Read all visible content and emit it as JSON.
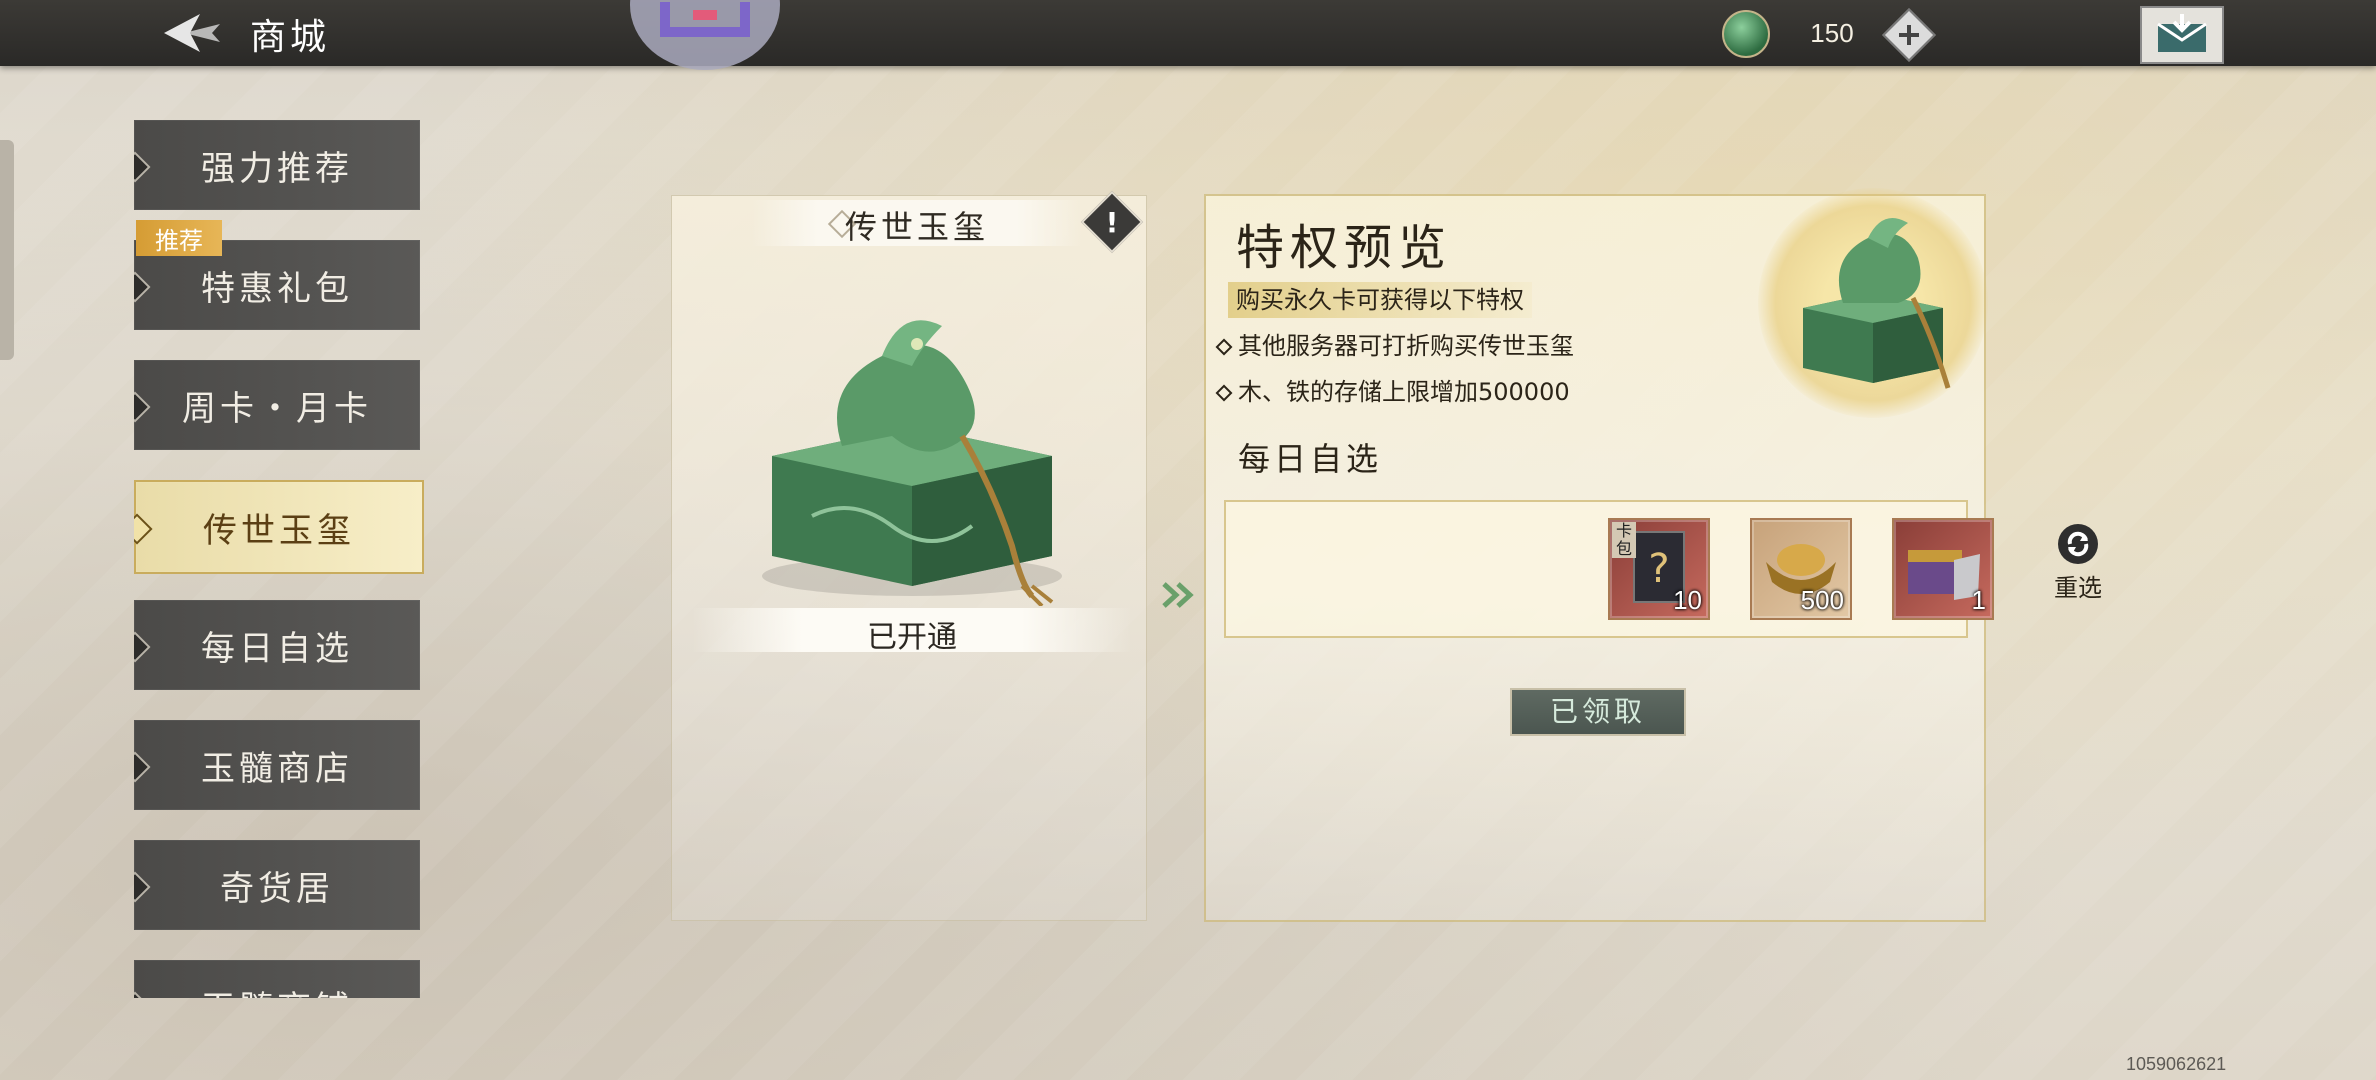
{
  "header": {
    "title": "商城",
    "currency_amount": "150"
  },
  "nav": {
    "items": [
      {
        "label": "强力推荐"
      },
      {
        "label": "特惠礼包"
      },
      {
        "label": "周卡・月卡"
      },
      {
        "label": "传世玉玺"
      },
      {
        "label": "每日自选"
      },
      {
        "label": "玉髓商店"
      },
      {
        "label": "奇货居"
      },
      {
        "label": "玉髓商铺"
      }
    ],
    "active_index": 3,
    "recommend_tag": "推荐"
  },
  "card": {
    "title": "传世玉玺",
    "info_icon": "!",
    "status": "已开通"
  },
  "panel": {
    "title": "特权预览",
    "subtitle": "购买永久卡可获得以下特权",
    "perks": [
      "其他服务器可打折购买传世玉玺",
      "木、铁的存储上限增加500000"
    ],
    "daily_label": "每日自选",
    "items": [
      {
        "name": "card-pack",
        "tag": "卡包",
        "count": "10"
      },
      {
        "name": "gold-ingot",
        "count": "500"
      },
      {
        "name": "treasure-chest",
        "count": "1"
      }
    ],
    "reroll_label": "重选",
    "claim_label": "已领取"
  },
  "footer": {
    "id": "1059062621"
  },
  "colors": {
    "topbar": "#2a2927",
    "nav_item": "#4b4a48",
    "nav_active": "#f7eec8",
    "gold_accent": "#c9ac5d",
    "claim_button": "#4b5650"
  }
}
